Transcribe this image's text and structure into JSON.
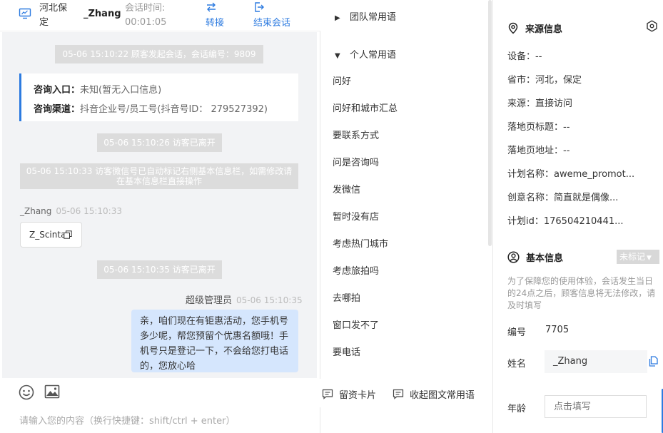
{
  "header": {
    "location": "河北保定",
    "username": "_Zhang",
    "session_time_label": "会话时间:",
    "session_time": "00:01:05",
    "transfer_label": "转接",
    "end_label": "结束会话"
  },
  "messages": {
    "sys1": "05-06 15:10:22 顾客发起会话，会话编号：9809",
    "entry_label": "咨询入口：",
    "entry_value": "未知(暂无入口信息)",
    "channel_label": "咨询渠道：",
    "channel_value": "抖音企业号/员工号(抖音号ID： 279527392)",
    "sys2": "05-06 15:10:26 访客已离开",
    "sys3": "05-06 15:10:33 访客微信号已自动标记右侧基本信息栏，如需修改请在基本信息栏直接操作",
    "visitor_name": "_Zhang",
    "visitor_time": "05-06 15:10:33",
    "visitor_card": "Z_Scinta",
    "sys4": "05-06 15:10:35 访客已离开",
    "agent_name": "超级管理员",
    "agent_time": "05-06 15:10:35",
    "agent_text": "亲，咱们现在有钜惠活动，您手机号多少呢，帮您预留个优惠名额哦！手机号只是登记一下，不会给您打电话的，您放心哈"
  },
  "input": {
    "placeholder": "请输入您的内容（换行快捷键：shift/ctrl + enter）"
  },
  "quick": {
    "team_group": "团队常用语",
    "personal_group": "个人常用语",
    "phrases": [
      "问好",
      "问好和城市汇总",
      "要联系方式",
      "问是咨询吗",
      "发微信",
      "暂时没有店",
      "考虑热门城市",
      "考虑旅拍吗",
      "去哪拍",
      "窗口发不了",
      "要电话"
    ],
    "card_btn": "留资卡片",
    "collapse_btn": "收起图文常用语"
  },
  "info": {
    "source_title": "来源信息",
    "device": "设备：--",
    "province": "省市：河北，保定",
    "source": "来源：直接访问",
    "landing_title": "落地页标题：--",
    "landing_url": "落地页地址：--",
    "plan_name": "计划名称：aweme_promot...",
    "creative_name": "创意名称：简直就是偶像...",
    "plan_id": "计划id：176504210441...",
    "basic_title": "基本信息",
    "tag": "未标记",
    "notice": "为了保障您的使用体验，会话发生当日的24点之后，顾客信息将无法修改，请及时填写",
    "id_label": "编号",
    "id_value": "7705",
    "name_label": "姓名",
    "name_value": "_Zhang",
    "age_label": "年龄",
    "age_placeholder": "点击填写"
  }
}
